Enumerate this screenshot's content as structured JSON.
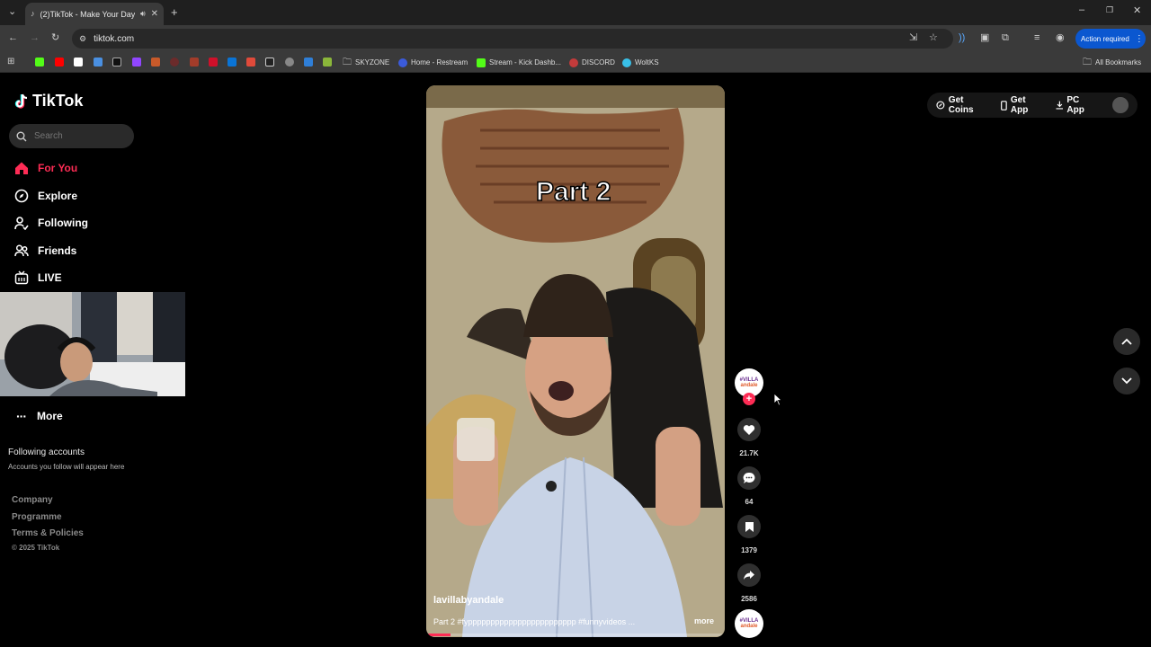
{
  "browser": {
    "tab_title": "(2)TikTok - Make Your Day",
    "url": "tiktok.com",
    "action_button": "Action required",
    "all_bookmarks": "All Bookmarks",
    "bookmarks": [
      {
        "label": "SKYZONE",
        "icon": "folder-icon"
      },
      {
        "label": "Home - Restream",
        "icon": "restream-icon"
      },
      {
        "label": "Stream - Kick Dashb...",
        "icon": "kick-icon"
      },
      {
        "label": "DISCORD",
        "icon": "discord-icon"
      },
      {
        "label": "WoltKS",
        "icon": "wolt-icon"
      }
    ]
  },
  "tiktok": {
    "logo": "TikTok",
    "search_placeholder": "Search",
    "nav": [
      {
        "label": "For You",
        "icon": "home-icon",
        "active": true
      },
      {
        "label": "Explore",
        "icon": "compass-icon"
      },
      {
        "label": "Following",
        "icon": "following-icon"
      },
      {
        "label": "Friends",
        "icon": "friends-icon"
      },
      {
        "label": "LIVE",
        "icon": "live-icon"
      }
    ],
    "more": "More",
    "following_heading": "Following accounts",
    "following_sub": "Accounts you follow will appear here",
    "footer": [
      "Company",
      "Programme",
      "Terms & Policies"
    ],
    "copyright": "© 2025 TikTok",
    "top_actions": {
      "coins": "Get Coins",
      "app": "Get App",
      "pc": "PC App"
    }
  },
  "video": {
    "overlay_text": "Part 2",
    "username": "lavillabyandale",
    "caption": "Part 2 #fypppppppppppppppppppppppp #funnyvideos ...",
    "more": "more",
    "progress": 0.08,
    "likes": "21.7K",
    "comments": "64",
    "saves": "1379",
    "shares": "2586",
    "avatar_text_top": "#VILLA",
    "avatar_text_bottom": "andale"
  },
  "colors": {
    "accent": "#fe2c55",
    "action_blue": "#0b57d0"
  }
}
